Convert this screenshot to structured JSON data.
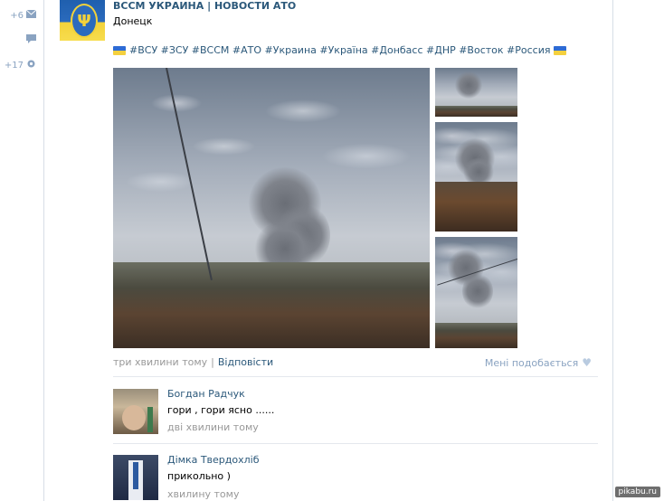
{
  "left_rail": {
    "items": [
      {
        "count": "+6",
        "icon": "mail-icon"
      },
      {
        "count": "",
        "icon": "comment-icon"
      },
      {
        "count": "+17",
        "icon": "gear-icon"
      }
    ]
  },
  "post": {
    "group_name": "ВССМ УКРАИНА | НОВОСТИ АТО",
    "text": "Донецк",
    "hashtags": "#ВСУ #ЗСУ #ВССМ #АТО #Украина #Україна #Донбасс #ДНР #Восток #Россия",
    "time": "три хвилини тому",
    "separator": "|",
    "reply_label": "Відповісти",
    "like_label": "Мені подобається"
  },
  "comments": [
    {
      "author": "Богдан Радчук",
      "text": "гори , гори ясно ......",
      "time": "дві хвилини тому"
    },
    {
      "author": "Дімка Твердохліб",
      "text": "прикольно )",
      "time": "хвилину тому"
    }
  ],
  "watermark": "pikabu.ru",
  "colors": {
    "link": "#2b587a",
    "muted": "#999999",
    "accent": "#8aa3c1"
  }
}
